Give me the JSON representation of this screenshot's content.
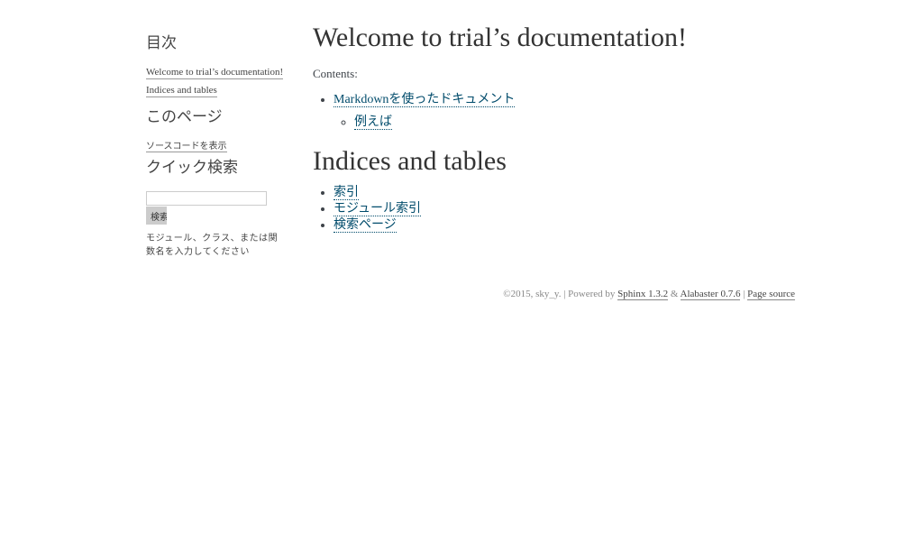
{
  "sidebar": {
    "toc_heading": "目次",
    "toc_links": [
      "Welcome to trial’s documentation!",
      "Indices and tables"
    ],
    "this_page_heading": "このページ",
    "show_source": "ソースコードを表示",
    "quick_search_heading": "クイック検索",
    "search_button": "検索",
    "search_hint": "モジュール、クラス、または関数名を入力してください"
  },
  "main": {
    "title": "Welcome to trial’s documentation!",
    "contents_label": "Contents:",
    "toc_item": "Markdownを使ったドキュメント",
    "toc_subitem": "例えば",
    "indices_heading": "Indices and tables",
    "indices": [
      "索引",
      "モジュール索引",
      "検索ページ"
    ]
  },
  "footer": {
    "copyright": "©2015, sky_y. | Powered by ",
    "sphinx": "Sphinx 1.3.2",
    "amp": " & ",
    "alabaster": "Alabaster 0.7.6",
    "sep": " | ",
    "page_source": "Page source"
  }
}
